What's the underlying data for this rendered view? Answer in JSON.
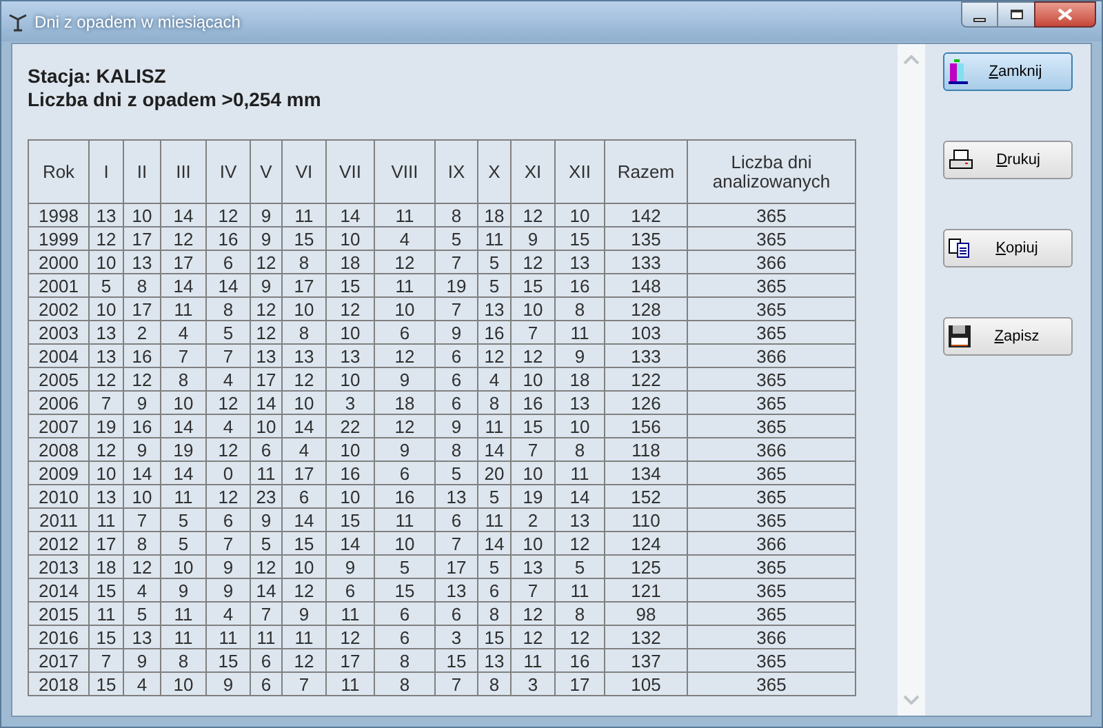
{
  "window": {
    "title": "Dni z opadem w miesiącach"
  },
  "station": "Stacja: KALISZ",
  "subtitle": "Liczba dni z opadem >0,254 mm",
  "table": {
    "columns": [
      "Rok",
      "I",
      "II",
      "III",
      "IV",
      "V",
      "VI",
      "VII",
      "VIII",
      "IX",
      "X",
      "XI",
      "XII",
      "Razem",
      "Liczba dni analizowanych"
    ],
    "rows": [
      [
        "1998",
        "13",
        "10",
        "14",
        "12",
        "9",
        "11",
        "14",
        "11",
        "8",
        "18",
        "12",
        "10",
        "142",
        "365"
      ],
      [
        "1999",
        "12",
        "17",
        "12",
        "16",
        "9",
        "15",
        "10",
        "4",
        "5",
        "11",
        "9",
        "15",
        "135",
        "365"
      ],
      [
        "2000",
        "10",
        "13",
        "17",
        "6",
        "12",
        "8",
        "18",
        "12",
        "7",
        "5",
        "12",
        "13",
        "133",
        "366"
      ],
      [
        "2001",
        "5",
        "8",
        "14",
        "14",
        "9",
        "17",
        "15",
        "11",
        "19",
        "5",
        "15",
        "16",
        "148",
        "365"
      ],
      [
        "2002",
        "10",
        "17",
        "11",
        "8",
        "12",
        "10",
        "12",
        "10",
        "7",
        "13",
        "10",
        "8",
        "128",
        "365"
      ],
      [
        "2003",
        "13",
        "2",
        "4",
        "5",
        "12",
        "8",
        "10",
        "6",
        "9",
        "16",
        "7",
        "11",
        "103",
        "365"
      ],
      [
        "2004",
        "13",
        "16",
        "7",
        "7",
        "13",
        "13",
        "13",
        "12",
        "6",
        "12",
        "12",
        "9",
        "133",
        "366"
      ],
      [
        "2005",
        "12",
        "12",
        "8",
        "4",
        "17",
        "12",
        "10",
        "9",
        "6",
        "4",
        "10",
        "18",
        "122",
        "365"
      ],
      [
        "2006",
        "7",
        "9",
        "10",
        "12",
        "14",
        "10",
        "3",
        "18",
        "6",
        "8",
        "16",
        "13",
        "126",
        "365"
      ],
      [
        "2007",
        "19",
        "16",
        "14",
        "4",
        "10",
        "14",
        "22",
        "12",
        "9",
        "11",
        "15",
        "10",
        "156",
        "365"
      ],
      [
        "2008",
        "12",
        "9",
        "19",
        "12",
        "6",
        "4",
        "10",
        "9",
        "8",
        "14",
        "7",
        "8",
        "118",
        "366"
      ],
      [
        "2009",
        "10",
        "14",
        "14",
        "0",
        "11",
        "17",
        "16",
        "6",
        "5",
        "20",
        "10",
        "11",
        "134",
        "365"
      ],
      [
        "2010",
        "13",
        "10",
        "11",
        "12",
        "23",
        "6",
        "10",
        "16",
        "13",
        "5",
        "19",
        "14",
        "152",
        "365"
      ],
      [
        "2011",
        "11",
        "7",
        "5",
        "6",
        "9",
        "14",
        "15",
        "11",
        "6",
        "11",
        "2",
        "13",
        "110",
        "365"
      ],
      [
        "2012",
        "17",
        "8",
        "5",
        "7",
        "5",
        "15",
        "14",
        "10",
        "7",
        "14",
        "10",
        "12",
        "124",
        "366"
      ],
      [
        "2013",
        "18",
        "12",
        "10",
        "9",
        "12",
        "10",
        "9",
        "5",
        "17",
        "5",
        "13",
        "5",
        "125",
        "365"
      ],
      [
        "2014",
        "15",
        "4",
        "9",
        "9",
        "14",
        "12",
        "6",
        "15",
        "13",
        "6",
        "7",
        "11",
        "121",
        "365"
      ],
      [
        "2015",
        "11",
        "5",
        "11",
        "4",
        "7",
        "9",
        "11",
        "6",
        "6",
        "8",
        "12",
        "8",
        "98",
        "365"
      ],
      [
        "2016",
        "15",
        "13",
        "11",
        "11",
        "11",
        "11",
        "12",
        "6",
        "3",
        "15",
        "12",
        "12",
        "132",
        "366"
      ],
      [
        "2017",
        "7",
        "9",
        "8",
        "15",
        "6",
        "12",
        "17",
        "8",
        "15",
        "13",
        "11",
        "16",
        "137",
        "365"
      ],
      [
        "2018",
        "15",
        "4",
        "10",
        "9",
        "6",
        "7",
        "11",
        "8",
        "7",
        "8",
        "3",
        "17",
        "105",
        "365"
      ]
    ]
  },
  "buttons": [
    {
      "kind": "close",
      "label": "Zamknij",
      "default": true
    },
    {
      "kind": "print",
      "label": "Drukuj",
      "default": false
    },
    {
      "kind": "copy",
      "label": "Kopiuj",
      "default": false
    },
    {
      "kind": "save",
      "label": "Zapisz",
      "default": false
    }
  ]
}
